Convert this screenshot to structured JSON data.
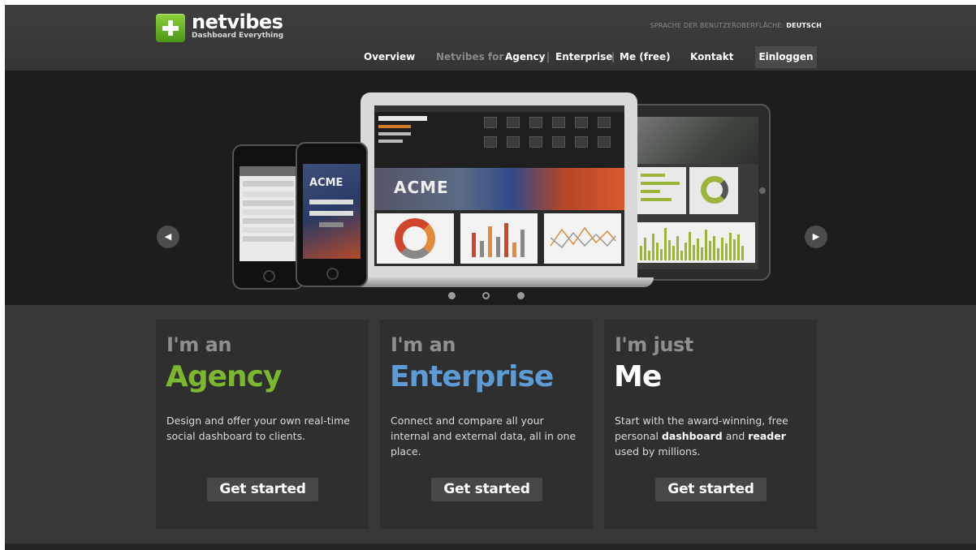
{
  "header": {
    "logo_name_a": "net",
    "logo_name_b": "vibes",
    "logo_tagline": "Dashboard Everything",
    "language_label": "SPRACHE DER BENUTZEROBERFLÄCHE:",
    "language_value": "DEUTSCH"
  },
  "nav": {
    "overview": "Overview",
    "netvibes_for": "Netvibes for",
    "agency": "Agency",
    "enterprise": "Enterprise",
    "me": "Me (free)",
    "kontakt": "Kontakt",
    "login": "Einloggen",
    "separator": "|"
  },
  "hero": {
    "prev_arrow": "◀",
    "next_arrow": "▶",
    "laptop_banner": "ACME",
    "phone_banner": "ACME",
    "slides": 3,
    "active_slide": 2
  },
  "cards": [
    {
      "pre": "I'm an",
      "title": "Agency",
      "description": "Design and offer your own real-time social dashboard to clients.",
      "cta": "Get started"
    },
    {
      "pre": "I'm an",
      "title": "Enterprise",
      "description": "Connect and compare all your internal and external data, all in one place.",
      "cta": "Get started"
    },
    {
      "pre": "I'm just",
      "title": "Me",
      "description_a": "Start with the award-winning, free personal ",
      "description_b": "dashboard",
      "description_c": " and ",
      "description_d": "reader",
      "description_e": " used by millions.",
      "cta": "Get started"
    }
  ],
  "colors": {
    "agency": "#7cb82f",
    "enterprise": "#5c9bd5",
    "logo_green": "#6cb52a"
  }
}
